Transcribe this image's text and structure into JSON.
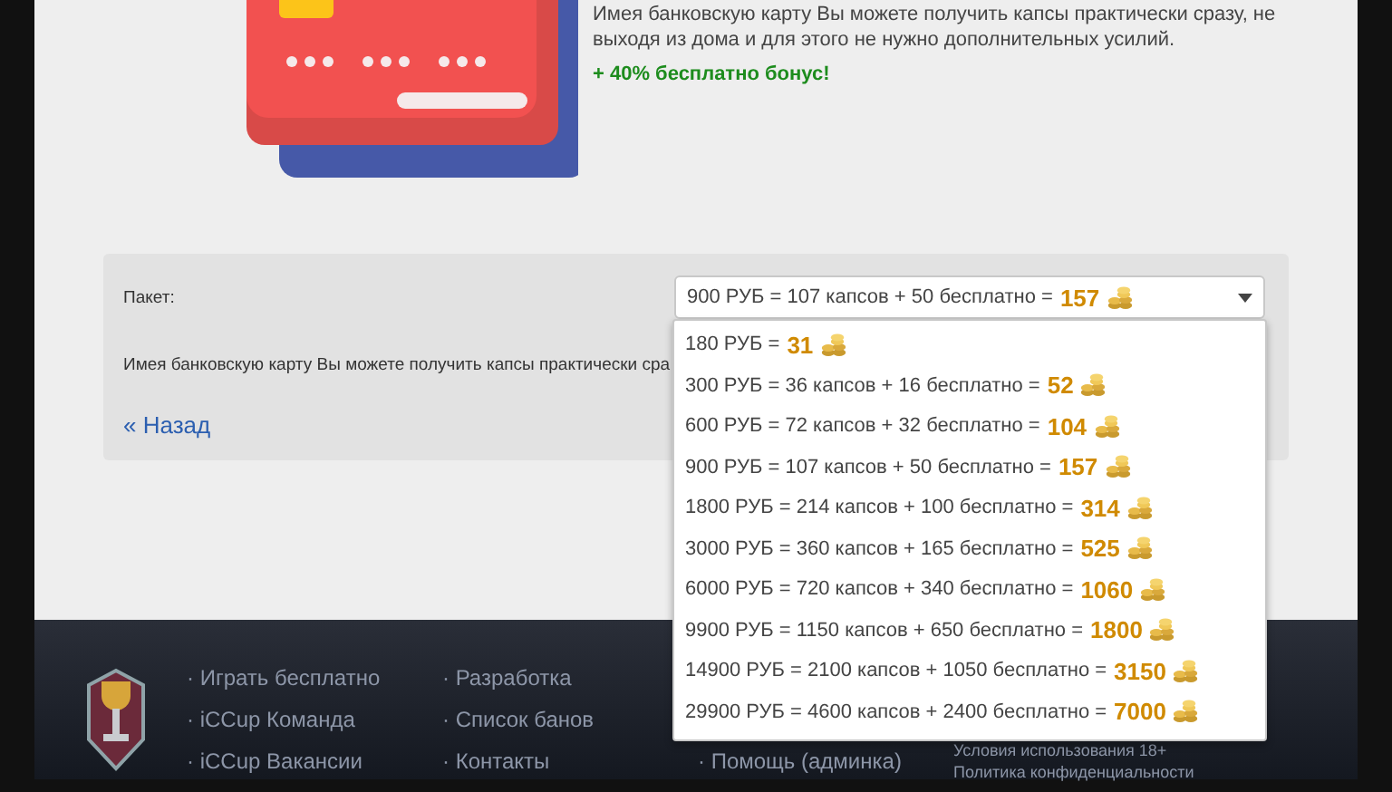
{
  "promo": {
    "description": "Имея банковскую карту Вы можете получить капсы практически сразу, не выходя из дома и для этого не нужно дополнительных усилий.",
    "bonus": "+ 40% бесплатно бонус!"
  },
  "form": {
    "label": "Пакет:",
    "value": {
      "price": "900 РУБ = 107 капсов + 50 бесплатно =",
      "total": "157"
    },
    "note": "Имея банковскую карту Вы можете получить капсы практически сра",
    "back_link": "« Назад"
  },
  "dropdown": [
    {
      "price": "180 РУБ =",
      "total": "31"
    },
    {
      "price": "300 РУБ = 36 капсов + 16 бесплатно =",
      "total": "52"
    },
    {
      "price": "600 РУБ = 72 капсов + 32 бесплатно =",
      "total": "104"
    },
    {
      "price": "900 РУБ = 107 капсов + 50 бесплатно =",
      "total": "157"
    },
    {
      "price": "1800 РУБ = 214 капсов + 100 бесплатно =",
      "total": "314"
    },
    {
      "price": "3000 РУБ = 360 капсов + 165 бесплатно =",
      "total": "525"
    },
    {
      "price": "6000 РУБ = 720 капсов + 340 бесплатно =",
      "total": "1060"
    },
    {
      "price": "9900 РУБ = 1150 капсов + 650 бесплатно =",
      "total": "1800"
    },
    {
      "price": "14900 РУБ = 2100 капсов + 1050 бесплатно =",
      "total": "3150"
    },
    {
      "price": "29900 РУБ = 4600 капсов + 2400 бесплатно =",
      "total": "7000"
    }
  ],
  "footer": {
    "columns": [
      [
        "· Играть бесплатно",
        "· iCCup Команда",
        "· iCCup Вакансии"
      ],
      [
        "· Разработка",
        "· Список банов",
        "· Контакты"
      ],
      [
        "· Помощь (админка)"
      ]
    ],
    "legal": [
      "Условия использования 18+",
      "Политика конфиденциальности"
    ]
  }
}
